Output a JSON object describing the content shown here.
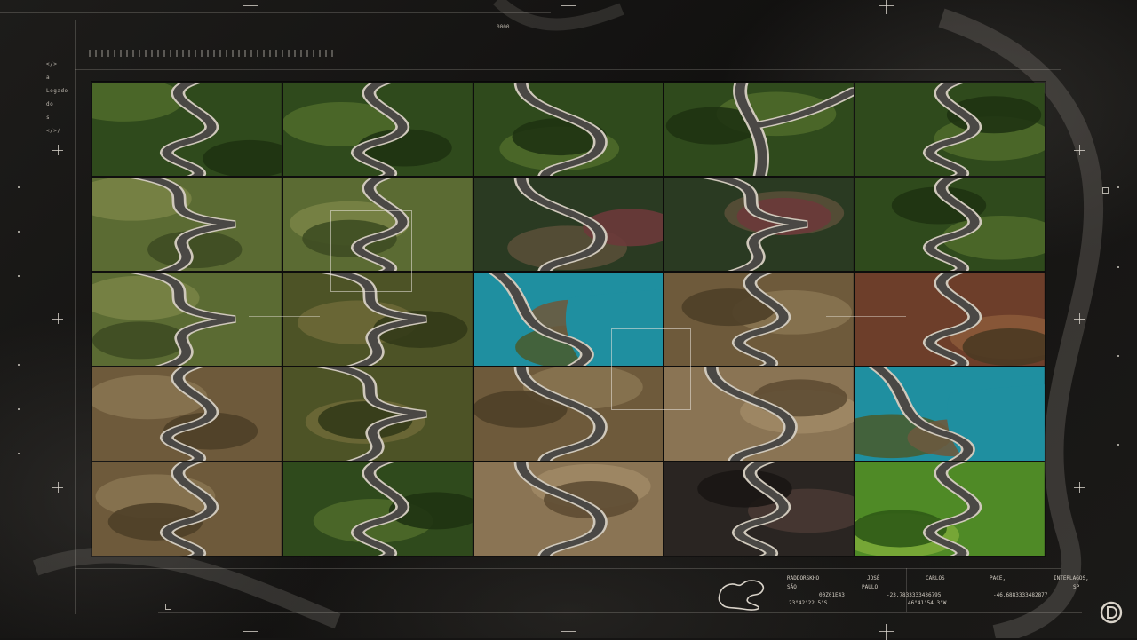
{
  "colors": {
    "background": "#151413",
    "hud_line": "#d2cdc4",
    "sea": "#1f8fa0",
    "grass_dark": "#35501f",
    "grass_light": "#6f8a3a",
    "dry_earth": "#7a6443",
    "road": "#4a4845"
  },
  "left_legend": {
    "items": [
      "</>",
      "a",
      "Legado",
      "do",
      "s",
      "</>/"
    ]
  },
  "top": {
    "label": "0000"
  },
  "grid": {
    "rows": 5,
    "columns": 5,
    "tiles": [
      {
        "terrain": "green",
        "road": "s-curve"
      },
      {
        "terrain": "green",
        "road": "s-curve"
      },
      {
        "terrain": "green",
        "road": "hairpin"
      },
      {
        "terrain": "green",
        "road": "fork"
      },
      {
        "terrain": "green",
        "road": "s-curve"
      },
      {
        "terrain": "meadow",
        "road": "switchback"
      },
      {
        "terrain": "meadow",
        "road": "s-curve"
      },
      {
        "terrain": "village",
        "road": "hairpin"
      },
      {
        "terrain": "village",
        "road": "switchback"
      },
      {
        "terrain": "green",
        "road": "s-curve"
      },
      {
        "terrain": "meadow",
        "road": "switchback"
      },
      {
        "terrain": "olive",
        "road": "switchback"
      },
      {
        "terrain": "coast",
        "road": "coast"
      },
      {
        "terrain": "dry",
        "road": "s-curve"
      },
      {
        "terrain": "red-earth",
        "road": "s-curve"
      },
      {
        "terrain": "dry",
        "road": "s-curve"
      },
      {
        "terrain": "olive",
        "road": "switchback"
      },
      {
        "terrain": "dry",
        "road": "hairpin"
      },
      {
        "terrain": "sand",
        "road": "hairpin"
      },
      {
        "terrain": "coast",
        "road": "coast"
      },
      {
        "terrain": "dry",
        "road": "s-curve"
      },
      {
        "terrain": "green",
        "road": "s-curve"
      },
      {
        "terrain": "sand",
        "road": "hairpin"
      },
      {
        "terrain": "dark",
        "road": "s-curve"
      },
      {
        "terrain": "bright-green",
        "road": "s-curve"
      }
    ]
  },
  "bottom_info": {
    "headers": [
      "RADDORSKHO",
      "JOSÉ",
      "CARLOS",
      "PACE,",
      "INTERLAGOS,"
    ],
    "row1": [
      "SÃO",
      "PAULO",
      "",
      "SP"
    ],
    "row2": [
      "00Z01E43",
      "-23.7833333436795",
      "-46.6883333482877"
    ],
    "row3": [
      "23°42'22.5\"S",
      "46°41'54.3\"W"
    ]
  },
  "logo": {
    "name": "discovery-d-logo"
  }
}
